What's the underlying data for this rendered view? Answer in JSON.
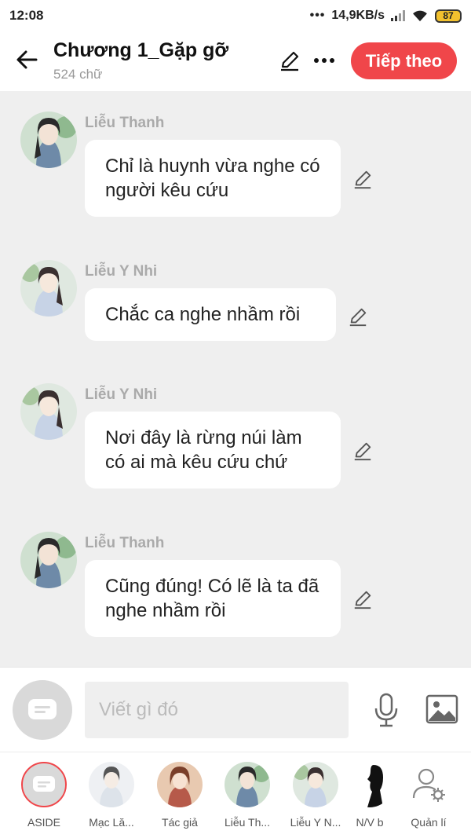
{
  "status_bar": {
    "time": "12:08",
    "network_speed": "14,9KB/s",
    "battery": "87"
  },
  "header": {
    "title": "Chương 1_Gặp gỡ",
    "word_count": "524 chữ",
    "next_button": "Tiếp theo"
  },
  "messages": [
    {
      "author": "Liễu Thanh",
      "text": "Chỉ là huynh vừa nghe có người kêu cứu",
      "avatar": "lieu-thanh"
    },
    {
      "author": "Liễu Y Nhi",
      "text": "Chắc ca nghe nhầm rồi",
      "avatar": "lieu-y-nhi"
    },
    {
      "author": "Liễu Y Nhi",
      "text": "Nơi đây là rừng núi làm có ai mà kêu cứu chứ",
      "avatar": "lieu-y-nhi"
    },
    {
      "author": "Liễu Thanh",
      "text": "Cũng đúng! Có lẽ là ta đã nghe nhầm rồi",
      "avatar": "lieu-thanh"
    }
  ],
  "input": {
    "placeholder": "Viết gì đó"
  },
  "characters": [
    {
      "label": "ASIDE",
      "icon": "aside-icon"
    },
    {
      "label": "Mạc Lă..."
    },
    {
      "label": "Tác giả"
    },
    {
      "label": "Liễu Th..."
    },
    {
      "label": "Liễu Y N..."
    },
    {
      "label": "N/V b"
    },
    {
      "label": "Quản lí",
      "icon": "manage-characters-icon"
    }
  ],
  "colors": {
    "accent": "#f0464a",
    "background": "#efefef",
    "bubble": "#ffffff"
  }
}
